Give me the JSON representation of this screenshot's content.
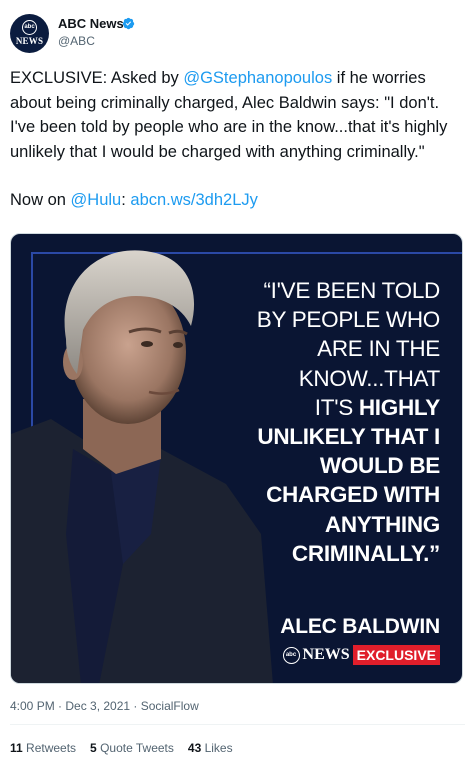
{
  "account": {
    "name": "ABC News",
    "handle": "@ABC",
    "avatar_text_top": "abc",
    "avatar_text_bottom": "NEWS",
    "verified_color": "#1d9bf0"
  },
  "tweet": {
    "line1_prefix": "EXCLUSIVE: Asked by ",
    "mention": "@GStephanopoulos",
    "line1_suffix": " if he worries about being criminally charged, Alec Baldwin says: \"I don't. I've been told by people who are in the know...that it's highly unlikely that I would be charged with anything criminally.\"",
    "now_on_prefix": "Now on ",
    "now_on_mention": "@Hulu",
    "now_on_colon": ": ",
    "link": "abcn.ws/3dh2LJy"
  },
  "media": {
    "quote_lines": [
      "“I'VE BEEN TOLD",
      "BY PEOPLE WHO",
      "ARE IN THE",
      "KNOW...THAT"
    ],
    "quote_line5_regular": "IT'S ",
    "quote_line5_bold": "HIGHLY",
    "quote_bold_lines": [
      "UNLIKELY THAT I",
      "WOULD BE",
      "CHARGED WITH",
      "ANYTHING",
      "CRIMINALLY.”"
    ],
    "speaker": "ALEC BALDWIN",
    "brand_logo": "abc",
    "brand_news": "NEWS",
    "brand_tag": "EXCLUSIVE"
  },
  "meta": {
    "timestamp": "4:00 PM · Dec 3, 2021 · SocialFlow"
  },
  "stats": {
    "retweets_count": "11",
    "retweets_label": " Retweets",
    "quotes_count": "5",
    "quotes_label": " Quote Tweets",
    "likes_count": "43",
    "likes_label": " Likes"
  }
}
